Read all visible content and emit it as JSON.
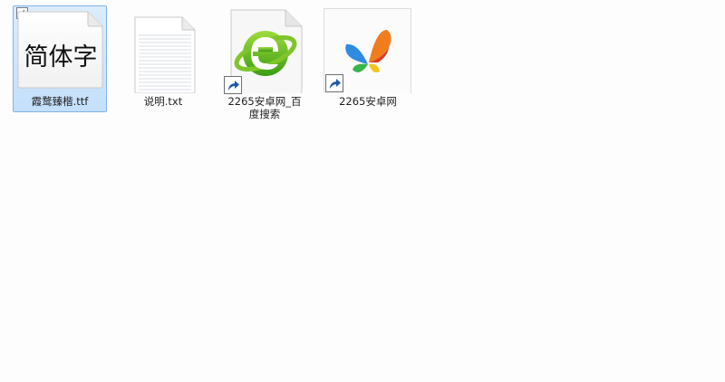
{
  "files": [
    {
      "name": "霞鹜臻楷.ttf",
      "preview_text": "简体字",
      "selected": true,
      "icon": "font-file-icon"
    },
    {
      "name": "说明.txt",
      "icon": "text-file-icon"
    },
    {
      "name": "2265安卓网_百度搜索",
      "icon": "ie-browser-shortcut-icon",
      "shortcut": true
    },
    {
      "name": "2265安卓网",
      "icon": "msn-butterfly-shortcut-icon",
      "shortcut": true
    }
  ],
  "check_mark": "✓"
}
